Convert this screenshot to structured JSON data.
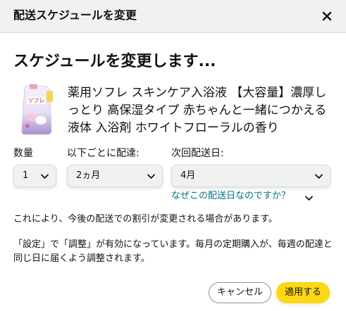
{
  "header": {
    "title": "配送スケジュールを変更",
    "close_icon": "close-icon"
  },
  "main": {
    "title": "スケジュールを変更します..."
  },
  "product": {
    "name": "薬用ソフレ スキンケア入浴液 【大容量】濃厚しっとり 高保湿タイプ 赤ちゃんと一緒につかえる 液体 入浴剤 ホワイトフローラルの香り",
    "image_icon": "product-image",
    "package_text": "ソフレ"
  },
  "fields": {
    "quantity": {
      "label": "数量",
      "value": "1"
    },
    "frequency": {
      "label": "以下ごとに配達:",
      "value": "2ヵ月"
    },
    "next_delivery": {
      "label": "次回配送日:",
      "value": "4月"
    }
  },
  "why_link": "なぜこの配送日なのですか？",
  "notices": [
    "これにより、今後の配送での割引が変更される場合があります。",
    "「設定」で「調整」が有効になっています。毎月の定期購入が、毎週の配達と同じ日に届くよう調整されます。"
  ],
  "buttons": {
    "cancel": "キャンセル",
    "apply": "適用する"
  },
  "colors": {
    "header_bg": "#f0f2f2",
    "link": "#007185",
    "apply_button": "#ffd814",
    "select_bg": "#f0f2f2"
  }
}
